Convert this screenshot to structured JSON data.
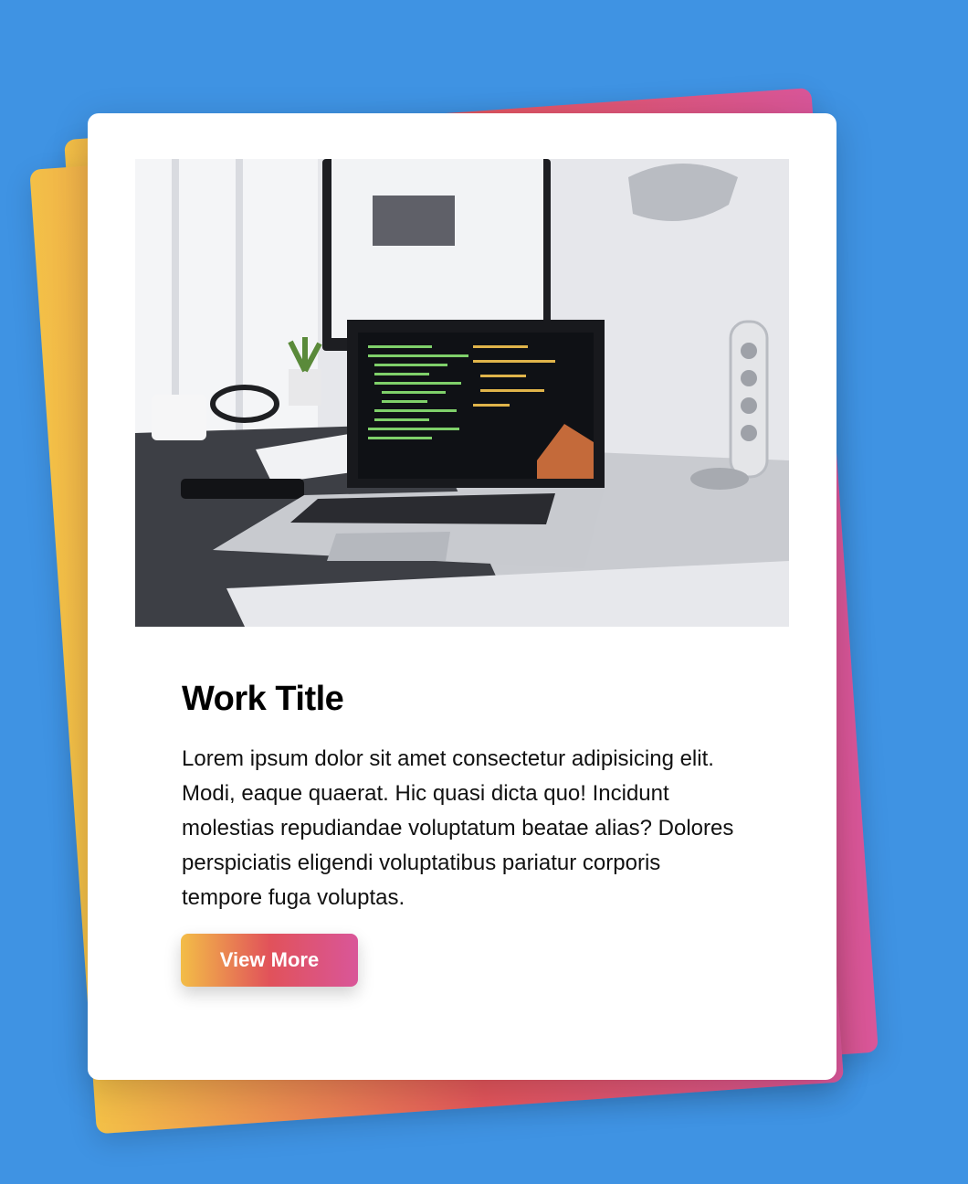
{
  "card": {
    "title": "Work Title",
    "description": "Lorem ipsum dolor sit amet consectetur adipisicing elit. Modi, eaque quaerat. Hic quasi dicta quo! Incidunt molestias repudiandae voluptatum beatae alias? Dolores perspiciatis eligendi voluptatibus pariatur corporis tempore fuga voluptas.",
    "button_label": "View More",
    "image_subject": "laptop-on-desk-photo"
  },
  "colors": {
    "background": "#3f93e3",
    "card": "#ffffff",
    "gradient_start": "#f3bd47",
    "gradient_mid": "#e1525a",
    "gradient_end": "#d95699"
  }
}
